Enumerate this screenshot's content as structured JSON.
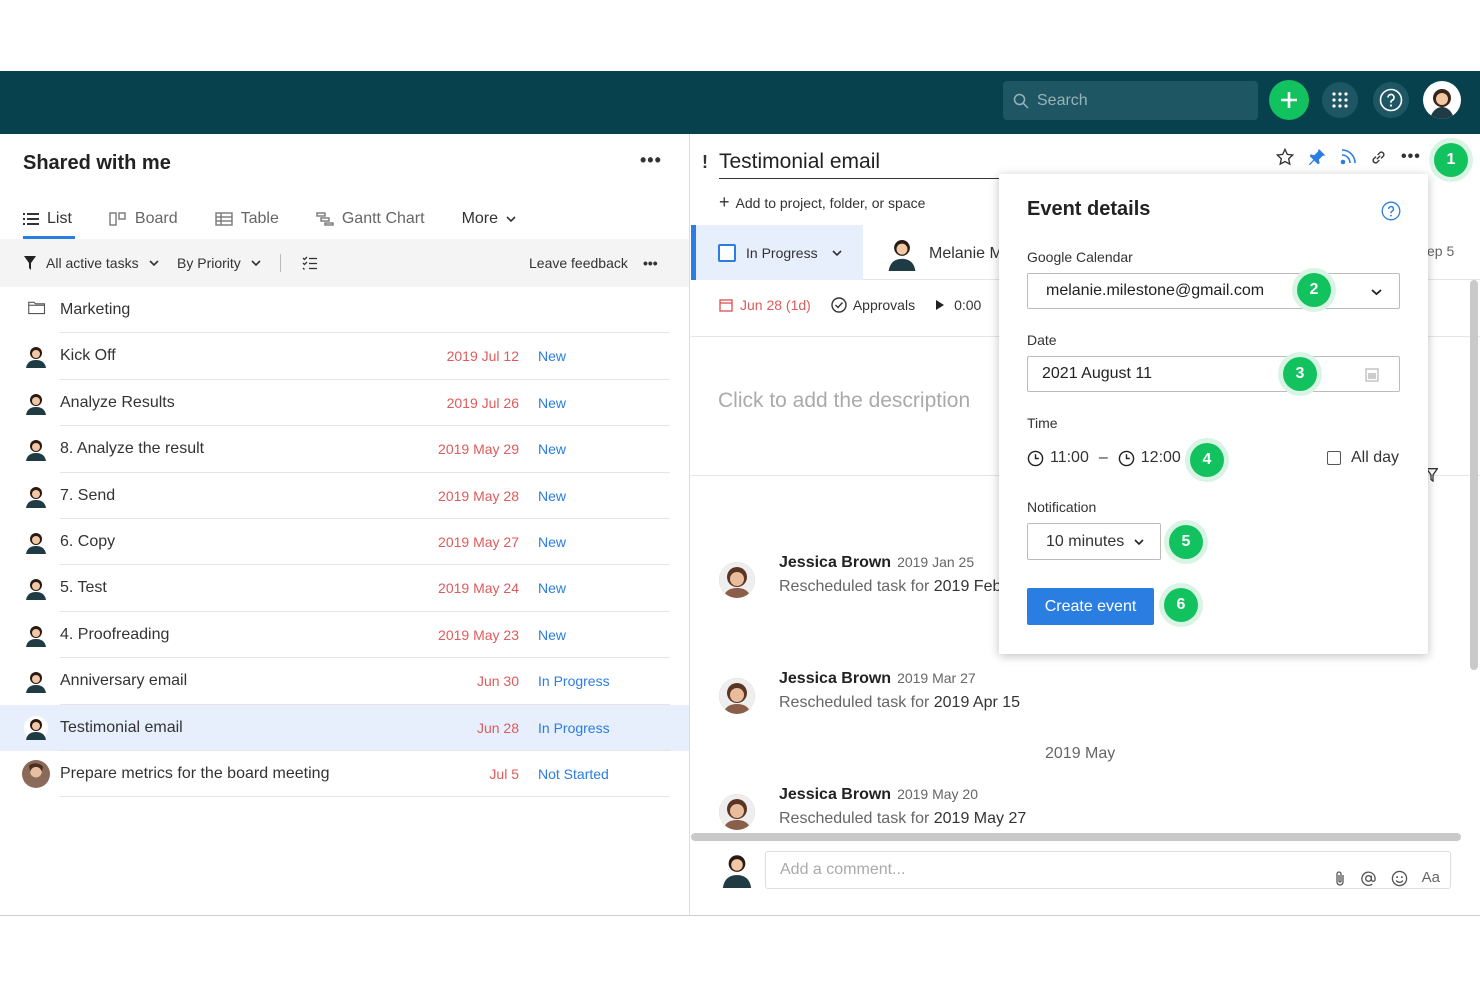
{
  "topbar": {
    "search_placeholder": "Search"
  },
  "left": {
    "title": "Shared with me",
    "more": "•••",
    "views": [
      {
        "label": "List",
        "icon": "list-icon"
      },
      {
        "label": "Board",
        "icon": "board-icon"
      },
      {
        "label": "Table",
        "icon": "table-icon"
      },
      {
        "label": "Gantt Chart",
        "icon": "gantt-icon"
      },
      {
        "label": "More",
        "icon": "chevron-down-icon"
      }
    ],
    "filters": {
      "active": "All active tasks",
      "priority": "By Priority",
      "feedback": "Leave feedback",
      "more": "•••"
    },
    "folder": "Marketing",
    "tasks": [
      {
        "name": "Kick Off",
        "date": "2019 Jul 12",
        "status": "New"
      },
      {
        "name": "Analyze Results",
        "date": "2019 Jul 26",
        "status": "New"
      },
      {
        "name": "8. Analyze the result",
        "date": "2019 May 29",
        "status": "New"
      },
      {
        "name": "7. Send",
        "date": "2019 May 28",
        "status": "New"
      },
      {
        "name": "6. Copy",
        "date": "2019 May 27",
        "status": "New"
      },
      {
        "name": "5. Test",
        "date": "2019 May 24",
        "status": "New"
      },
      {
        "name": "4. Proofreading",
        "date": "2019 May 23",
        "status": "New"
      },
      {
        "name": "Anniversary email",
        "date": "Jun 30",
        "status": "In Progress"
      },
      {
        "name": "Testimonial email",
        "date": "Jun 28",
        "status": "In Progress"
      },
      {
        "name": "Prepare metrics for the board meeting",
        "date": "Jul 5",
        "status": "Not Started"
      }
    ]
  },
  "right": {
    "excl": "!",
    "title": "Testimonial email",
    "add_project": "Add to project, folder, or space",
    "status": "In Progress",
    "assignee": "Melanie M",
    "step": "ep 5",
    "date": "Jun 28 (1d)",
    "approvals": "Approvals",
    "timer": "0:00",
    "description": "Click to add the description",
    "activity": [
      {
        "who": "Jessica Brown",
        "when": "2019 Jan 25",
        "text": "Rescheduled task for ",
        "target": "2019 Feb"
      },
      {
        "who": "Jessica Brown",
        "when": "2019 Mar 27",
        "text": "Rescheduled task for ",
        "target": "2019 Apr 15"
      },
      {
        "who": "Jessica Brown",
        "when": "2019 May 20",
        "text": "Rescheduled task for ",
        "target": "2019 May 27"
      }
    ],
    "month": "2019 May",
    "comment_placeholder": "Add a comment...",
    "comment_aa": "Aa"
  },
  "popup": {
    "title": "Event details",
    "calendar_label": "Google Calendar",
    "calendar_value": "melanie.milestone@gmail.com",
    "date_label": "Date",
    "date_value": "2021 August 11",
    "time_label": "Time",
    "time_start": "11:00",
    "time_sep": "–",
    "time_end": "12:00",
    "allday": "All day",
    "notif_label": "Notification",
    "notif_value": "10 minutes",
    "button": "Create event"
  },
  "badges": [
    "1",
    "2",
    "3",
    "4",
    "5",
    "6"
  ],
  "colors": {
    "topbar": "#07414d",
    "accent": "#2a7de1",
    "badge": "#12c25f",
    "date_red": "#e05a5a"
  }
}
